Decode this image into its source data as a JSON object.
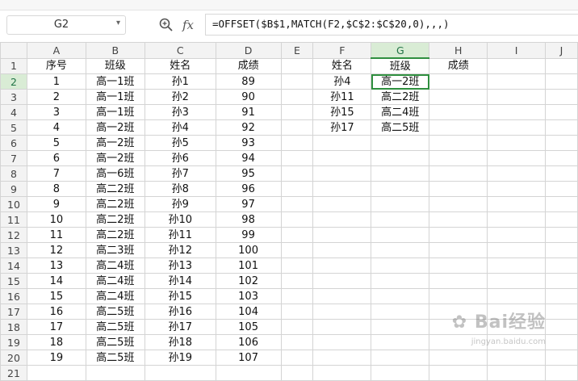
{
  "name_box": "G2",
  "formula": "=OFFSET($B$1,MATCH(F2,$C$2:$C$20,0),,,)",
  "icons": {
    "zoom": "zoom-icon",
    "fx": "function-icon",
    "dropdown": "chevron-down-icon"
  },
  "fx_label": "fx",
  "columns": [
    "A",
    "B",
    "C",
    "D",
    "E",
    "F",
    "G",
    "H",
    "I",
    "J"
  ],
  "row_numbers": [
    "1",
    "2",
    "3",
    "4",
    "5",
    "6",
    "7",
    "8",
    "9",
    "10",
    "11",
    "12",
    "13",
    "14",
    "15",
    "16",
    "17",
    "18",
    "19",
    "20",
    "21"
  ],
  "rows": [
    [
      "序号",
      "班级",
      "姓名",
      "成绩",
      "",
      "姓名",
      "班级",
      "成绩",
      "",
      ""
    ],
    [
      "1",
      "高一1班",
      "孙1",
      "89",
      "",
      "孙4",
      "高一2班",
      "",
      "",
      ""
    ],
    [
      "2",
      "高一1班",
      "孙2",
      "90",
      "",
      "孙11",
      "高二2班",
      "",
      "",
      ""
    ],
    [
      "3",
      "高一1班",
      "孙3",
      "91",
      "",
      "孙15",
      "高二4班",
      "",
      "",
      ""
    ],
    [
      "4",
      "高一2班",
      "孙4",
      "92",
      "",
      "孙17",
      "高二5班",
      "",
      "",
      ""
    ],
    [
      "5",
      "高一2班",
      "孙5",
      "93",
      "",
      "",
      "",
      "",
      "",
      ""
    ],
    [
      "6",
      "高一2班",
      "孙6",
      "94",
      "",
      "",
      "",
      "",
      "",
      ""
    ],
    [
      "7",
      "高一6班",
      "孙7",
      "95",
      "",
      "",
      "",
      "",
      "",
      ""
    ],
    [
      "8",
      "高二2班",
      "孙8",
      "96",
      "",
      "",
      "",
      "",
      "",
      ""
    ],
    [
      "9",
      "高二2班",
      "孙9",
      "97",
      "",
      "",
      "",
      "",
      "",
      ""
    ],
    [
      "10",
      "高二2班",
      "孙10",
      "98",
      "",
      "",
      "",
      "",
      "",
      ""
    ],
    [
      "11",
      "高二2班",
      "孙11",
      "99",
      "",
      "",
      "",
      "",
      "",
      ""
    ],
    [
      "12",
      "高二3班",
      "孙12",
      "100",
      "",
      "",
      "",
      "",
      "",
      ""
    ],
    [
      "13",
      "高二4班",
      "孙13",
      "101",
      "",
      "",
      "",
      "",
      "",
      ""
    ],
    [
      "14",
      "高二4班",
      "孙14",
      "102",
      "",
      "",
      "",
      "",
      "",
      ""
    ],
    [
      "15",
      "高二4班",
      "孙15",
      "103",
      "",
      "",
      "",
      "",
      "",
      ""
    ],
    [
      "16",
      "高二5班",
      "孙16",
      "104",
      "",
      "",
      "",
      "",
      "",
      ""
    ],
    [
      "17",
      "高二5班",
      "孙17",
      "105",
      "",
      "",
      "",
      "",
      "",
      ""
    ],
    [
      "18",
      "高二5班",
      "孙18",
      "106",
      "",
      "",
      "",
      "",
      "",
      ""
    ],
    [
      "19",
      "高二5班",
      "孙19",
      "107",
      "",
      "",
      "",
      "",
      "",
      ""
    ],
    [
      "",
      "",
      "",
      "",
      "",
      "",
      "",
      "",
      "",
      ""
    ]
  ],
  "active_cell": {
    "row_index": 1,
    "col_index": 6
  },
  "watermark": {
    "text": "Bai经验",
    "url": "jingyan.baidu.com"
  },
  "colors": {
    "selection": "#2f8f3f",
    "header_bg": "#f3f3f3",
    "grid": "#d4d4d4"
  }
}
